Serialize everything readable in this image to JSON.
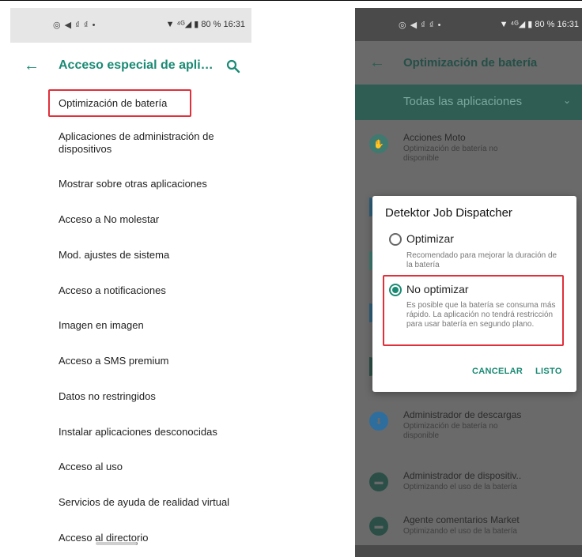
{
  "left_screen": {
    "status": {
      "icons": "◎ ◀ ₫ ₫ •",
      "right": "▼ ⁴ᴳ◢ ▮ 80 % 16:31"
    },
    "title": "Acceso especial de apli…",
    "items": [
      {
        "label": "Optimización de batería"
      },
      {
        "label": "Aplicaciones de administración de dispositivos"
      },
      {
        "label": "Mostrar sobre otras aplicaciones"
      },
      {
        "label": "Acceso a No molestar"
      },
      {
        "label": "Mod. ajustes de sistema"
      },
      {
        "label": "Acceso a notificaciones"
      },
      {
        "label": "Imagen en imagen"
      },
      {
        "label": "Acceso a SMS premium"
      },
      {
        "label": "Datos no restringidos"
      },
      {
        "label": "Instalar aplicaciones desconocidas"
      },
      {
        "label": "Acceso al uso"
      },
      {
        "label": "Servicios de ayuda de realidad virtual"
      },
      {
        "label": "Acceso al directorio"
      }
    ],
    "colors": {
      "accent": "#1b8a74",
      "highlight": "#e0303a"
    }
  },
  "right_screen": {
    "status": {
      "icons": "◎ ◀ ₫ ₫ •",
      "right": "▼ ⁴ᴳ◢ ▮ 80 % 16:31"
    },
    "title": "Optimización de batería",
    "filter": "Todas las aplicaciones",
    "apps": [
      {
        "name": "Acciones Moto",
        "status": "Optimización de batería no disponible",
        "icon": "hand-icon"
      },
      {
        "name": "Administrador de descargas",
        "status": "Optimización de batería no disponible",
        "icon": "download-icon"
      },
      {
        "name": "Administrador de dispositiv..",
        "status": "Optimizando el uso de la batería",
        "icon": "android-icon"
      },
      {
        "name": "Agente comentarios Market",
        "status": "Optimizando el uso de la batería",
        "icon": "android-icon"
      }
    ],
    "dialog": {
      "title": "Detektor Job Dispatcher",
      "options": [
        {
          "label": "Optimizar",
          "description": "Recomendado para mejorar la duración de la batería",
          "selected": false
        },
        {
          "label": "No optimizar",
          "description": "Es posible que la batería se consuma más rápido. La aplicación no tendrá restricción para usar batería en segundo plano.",
          "selected": true
        }
      ],
      "cancel_label": "CANCELAR",
      "ok_label": "LISTO"
    },
    "colors": {
      "filter_bar": "#2f5d54",
      "scrim": "#6a6a6a"
    }
  }
}
